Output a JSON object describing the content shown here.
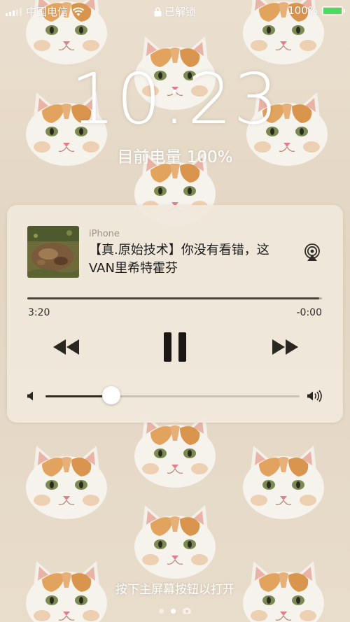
{
  "status_bar": {
    "carrier": "中国电信",
    "lock_status": "已解锁",
    "battery_percent": "100%",
    "battery_level": 1.0,
    "battery_color": "#4cd964"
  },
  "lock_screen": {
    "time": "10:23",
    "battery_status": "目前电量 100%"
  },
  "now_playing": {
    "source": "iPhone",
    "title_line1": "【真.原始技术】你没有看错，这",
    "title_line2": "VAN里希特霍芬",
    "elapsed": "3:20",
    "remaining": "-0:00",
    "progress": 0.99,
    "volume": 0.26,
    "icons": {
      "airplay": "airplay-icon",
      "rewind": "rewind-icon",
      "pause": "pause-icon",
      "forward": "fast-forward-icon",
      "volume_low": "volume-low-icon",
      "volume_high": "volume-high-icon"
    }
  },
  "footer": {
    "unlock_hint": "按下主屏幕按钮以打开",
    "page_count": 3,
    "active_page": 1
  }
}
